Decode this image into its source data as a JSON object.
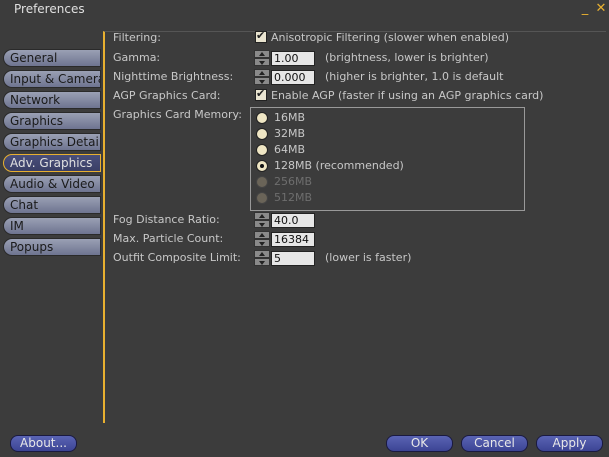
{
  "window": {
    "title": "Preferences",
    "minimize_glyph": "_",
    "close_glyph": "✕"
  },
  "tabs": [
    {
      "label": "General"
    },
    {
      "label": "Input & Camera"
    },
    {
      "label": "Network"
    },
    {
      "label": "Graphics"
    },
    {
      "label": "Graphics Detail"
    },
    {
      "label": "Adv. Graphics",
      "active": true
    },
    {
      "label": "Audio & Video"
    },
    {
      "label": "Chat"
    },
    {
      "label": "IM"
    },
    {
      "label": "Popups"
    }
  ],
  "settings": {
    "filtering": {
      "label": "Filtering:",
      "checkbox_label": "Anisotropic Filtering (slower when enabled)",
      "checked": true
    },
    "gamma": {
      "label": "Gamma:",
      "value": "1.00",
      "hint": "(brightness, lower is brighter)"
    },
    "nighttime": {
      "label": "Nighttime Brightness:",
      "value": "0.000",
      "hint": "(higher is brighter, 1.0 is default"
    },
    "agp": {
      "label": "AGP Graphics Card:",
      "checkbox_label": "Enable AGP (faster if using an AGP graphics card)",
      "checked": true
    },
    "memory": {
      "label": "Graphics Card Memory:",
      "options": [
        {
          "label": "16MB",
          "enabled": true,
          "selected": false
        },
        {
          "label": "32MB",
          "enabled": true,
          "selected": false
        },
        {
          "label": "64MB",
          "enabled": true,
          "selected": false
        },
        {
          "label": "128MB (recommended)",
          "enabled": true,
          "selected": true
        },
        {
          "label": "256MB",
          "enabled": false,
          "selected": false
        },
        {
          "label": "512MB",
          "enabled": false,
          "selected": false
        }
      ]
    },
    "fog": {
      "label": "Fog Distance Ratio:",
      "value": "40.0"
    },
    "particles": {
      "label": "Max. Particle Count:",
      "value": "16384"
    },
    "outfit": {
      "label": "Outfit Composite Limit:",
      "value": "5",
      "hint": "(lower is faster)"
    }
  },
  "buttons": {
    "about": "About...",
    "ok": "OK",
    "cancel": "Cancel",
    "apply": "Apply"
  },
  "colors": {
    "background": "#3c3c3c",
    "accent": "#e8b030",
    "tab_active": "#4a4f7a",
    "button": "#4a54a4"
  }
}
